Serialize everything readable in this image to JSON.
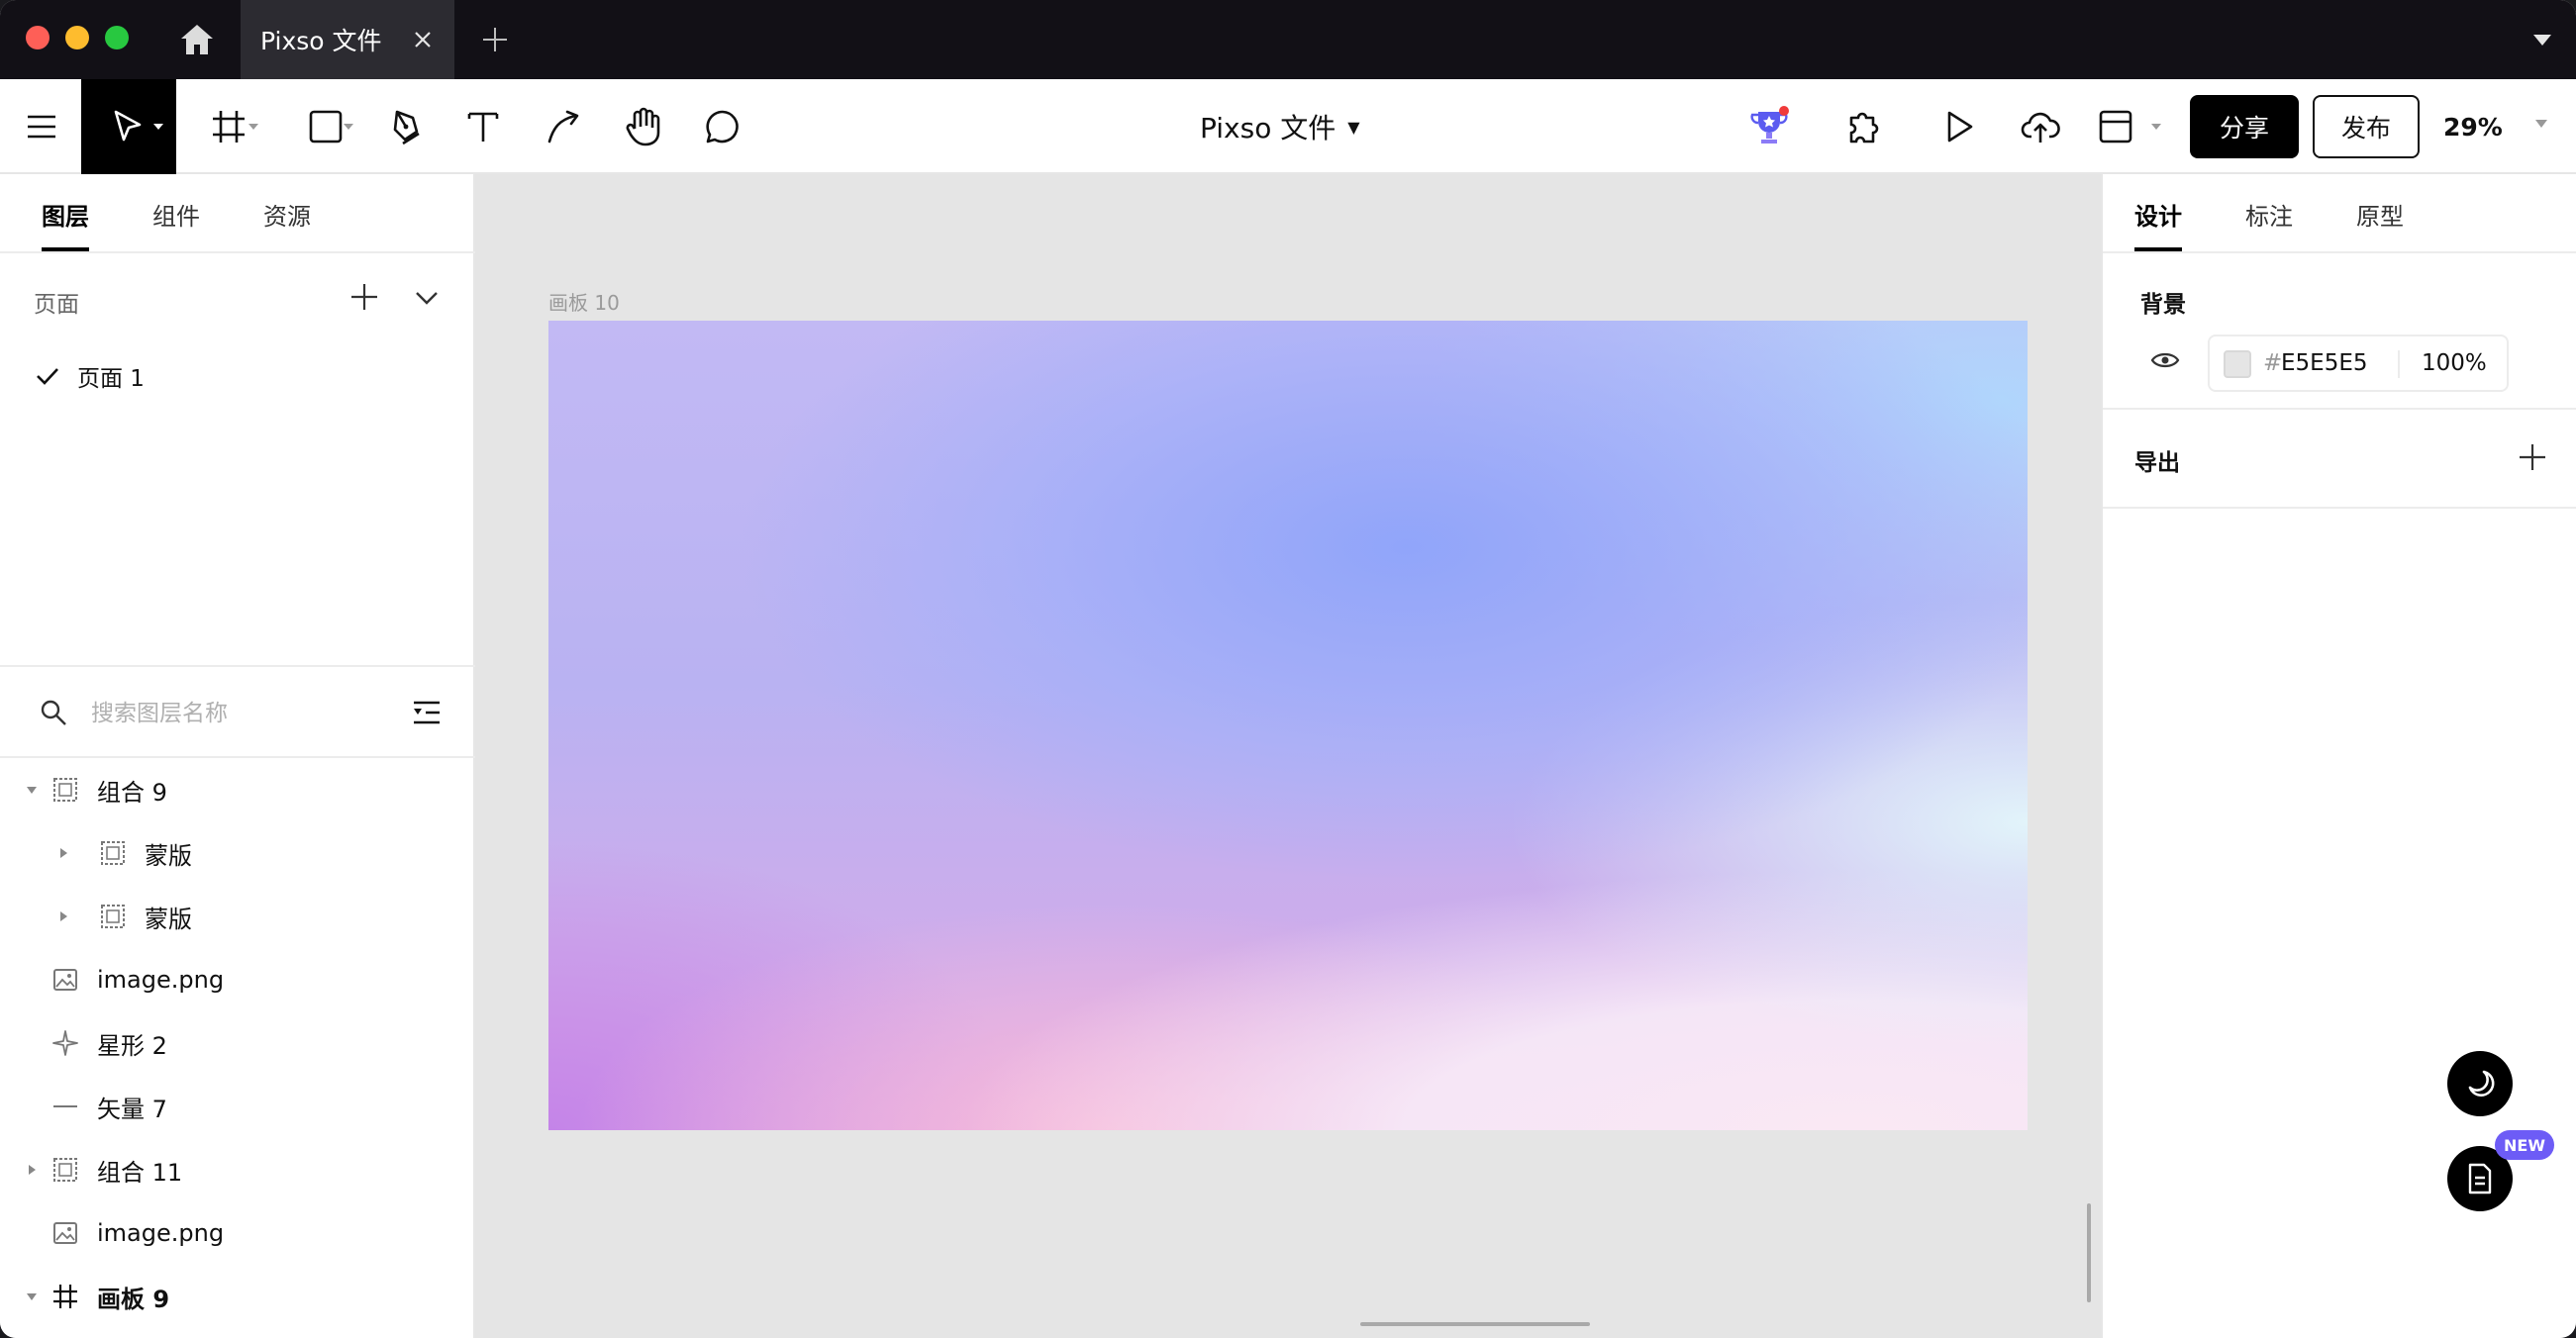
{
  "window": {
    "tab_title": "Pixso 文件"
  },
  "toolbar": {
    "doc_title": "Pixso 文件",
    "share_label": "分享",
    "publish_label": "发布",
    "zoom": "29%"
  },
  "left_panel": {
    "tabs": [
      {
        "label": "图层",
        "active": true
      },
      {
        "label": "组件",
        "active": false
      },
      {
        "label": "资源",
        "active": false
      }
    ],
    "pages_header": "页面",
    "pages": [
      {
        "label": "页面 1",
        "current": true
      }
    ],
    "search_placeholder": "搜索图层名称",
    "layers": [
      {
        "name": "组合 9",
        "type": "group",
        "expanded": true,
        "indent": 0
      },
      {
        "name": "蒙版",
        "type": "group",
        "expanded": false,
        "indent": 1
      },
      {
        "name": "蒙版",
        "type": "group",
        "expanded": false,
        "indent": 1
      },
      {
        "name": "image.png",
        "type": "image",
        "indent": 0
      },
      {
        "name": "星形 2",
        "type": "star",
        "indent": 0
      },
      {
        "name": "矢量 7",
        "type": "vector",
        "indent": 0
      },
      {
        "name": "组合 11",
        "type": "group",
        "expanded": false,
        "indent": 0
      },
      {
        "name": "image.png",
        "type": "image",
        "indent": 0
      },
      {
        "name": "画板 9",
        "type": "frame",
        "expanded": true,
        "indent": 0
      }
    ]
  },
  "canvas": {
    "frame_label": "画板 10",
    "background": "#E5E5E5"
  },
  "right_panel": {
    "tabs": [
      {
        "label": "设计",
        "active": true
      },
      {
        "label": "标注",
        "active": false
      },
      {
        "label": "原型",
        "active": false
      }
    ],
    "background_header": "背景",
    "hash": "#",
    "background_hex": "E5E5E5",
    "background_opacity": "100%",
    "export_header": "导出"
  },
  "floating": {
    "new_badge": "NEW"
  },
  "colors": {
    "titlebar": "#121016",
    "accent_black": "#000000",
    "badge_purple": "#6d5cf6",
    "notification_red": "#f03a3a"
  },
  "icons": {
    "home": "home-icon",
    "menu": "hamburger-menu-icon",
    "move": "move-cursor-icon",
    "frame": "frame-icon",
    "rectangle": "rectangle-icon",
    "pen": "pen-icon",
    "text": "text-icon",
    "connector": "connector-icon",
    "hand": "hand-icon",
    "comment": "comment-icon",
    "trophy": "trophy-icon",
    "plugin": "plugin-icon",
    "play": "play-icon",
    "upload": "cloud-upload-icon",
    "layout": "layout-icon",
    "eye": "eye-icon",
    "moon": "moon-icon",
    "document": "document-icon"
  }
}
